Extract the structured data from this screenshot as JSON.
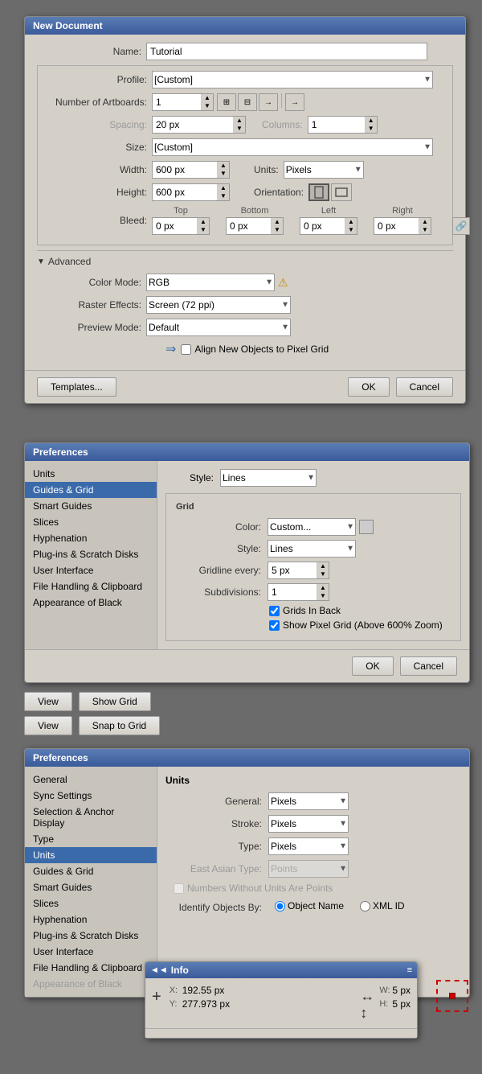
{
  "new_document": {
    "title": "New Document",
    "name_label": "Name:",
    "name_value": "Tutorial",
    "profile_label": "Profile:",
    "profile_value": "[Custom]",
    "artboards_label": "Number of Artboards:",
    "artboards_value": "1",
    "spacing_label": "Spacing:",
    "spacing_value": "20 px",
    "columns_label": "Columns:",
    "columns_value": "1",
    "size_label": "Size:",
    "size_value": "[Custom]",
    "width_label": "Width:",
    "width_value": "600 px",
    "units_label": "Units:",
    "units_value": "Pixels",
    "height_label": "Height:",
    "height_value": "600 px",
    "orientation_label": "Orientation:",
    "bleed_label": "Bleed:",
    "bleed_top_label": "Top",
    "bleed_top_value": "0 px",
    "bleed_bottom_label": "Bottom",
    "bleed_bottom_value": "0 px",
    "bleed_left_label": "Left",
    "bleed_left_value": "0 px",
    "bleed_right_label": "Right",
    "bleed_right_value": "0 px",
    "advanced_label": "Advanced",
    "color_mode_label": "Color Mode:",
    "color_mode_value": "RGB",
    "raster_effects_label": "Raster Effects:",
    "raster_effects_value": "Screen (72 ppi)",
    "preview_mode_label": "Preview Mode:",
    "preview_mode_value": "Default",
    "align_label": "Align New Objects to Pixel Grid",
    "templates_btn": "Templates...",
    "ok_btn": "OK",
    "cancel_btn": "Cancel"
  },
  "preferences_top": {
    "title": "Preferences",
    "sidebar_items": [
      {
        "label": "Units",
        "active": false
      },
      {
        "label": "Guides & Grid",
        "active": true
      },
      {
        "label": "Smart Guides",
        "active": false
      },
      {
        "label": "Slices",
        "active": false
      },
      {
        "label": "Hyphenation",
        "active": false
      },
      {
        "label": "Plug-ins & Scratch Disks",
        "active": false
      },
      {
        "label": "User Interface",
        "active": false
      },
      {
        "label": "File Handling & Clipboard",
        "active": false
      },
      {
        "label": "Appearance of Black",
        "active": false
      }
    ],
    "guides_style_label": "Style:",
    "guides_style_value": "Lines",
    "grid_title": "Grid",
    "grid_color_label": "Color:",
    "grid_color_value": "Custom...",
    "grid_style_label": "Style:",
    "grid_style_value": "Lines",
    "gridline_label": "Gridline every:",
    "gridline_value": "5 px",
    "subdivisions_label": "Subdivisions:",
    "subdivisions_value": "1",
    "grids_in_back_label": "Grids In Back",
    "show_pixel_grid_label": "Show Pixel Grid (Above 600% Zoom)",
    "ok_btn": "OK",
    "cancel_btn": "Cancel"
  },
  "view_buttons": {
    "view_label1": "View",
    "show_grid_label": "Show Grid",
    "view_label2": "View",
    "snap_to_grid_label": "Snap to Grid"
  },
  "preferences_bottom": {
    "title": "Preferences",
    "sidebar_items": [
      {
        "label": "General",
        "active": false
      },
      {
        "label": "Sync Settings",
        "active": false
      },
      {
        "label": "Selection & Anchor Display",
        "active": false
      },
      {
        "label": "Type",
        "active": false
      },
      {
        "label": "Units",
        "active": true
      },
      {
        "label": "Guides & Grid",
        "active": false
      },
      {
        "label": "Smart Guides",
        "active": false
      },
      {
        "label": "Slices",
        "active": false
      },
      {
        "label": "Hyphenation",
        "active": false
      },
      {
        "label": "Plug-ins & Scratch Disks",
        "active": false
      },
      {
        "label": "User Interface",
        "active": false
      },
      {
        "label": "File Handling & Clipboard",
        "active": false
      },
      {
        "label": "Appearance of Black",
        "active": false
      }
    ],
    "units_title": "Units",
    "general_label": "General:",
    "general_value": "Pixels",
    "stroke_label": "Stroke:",
    "stroke_value": "Pixels",
    "type_label": "Type:",
    "type_value": "Pixels",
    "east_asian_label": "East Asian Type:",
    "east_asian_value": "Points",
    "numbers_label": "Numbers Without Units Are Points",
    "identify_label": "Identify Objects By:",
    "object_name_label": "Object Name",
    "xml_id_label": "XML ID"
  },
  "info_panel": {
    "title": "Info",
    "x_label": "X:",
    "x_value": "192.55 px",
    "y_label": "Y:",
    "y_value": "277.973 px",
    "w_label": "W:",
    "w_value": "5 px",
    "h_label": "H:",
    "h_value": "5 px",
    "collapse_icon": "◄◄",
    "menu_icon": "≡"
  }
}
